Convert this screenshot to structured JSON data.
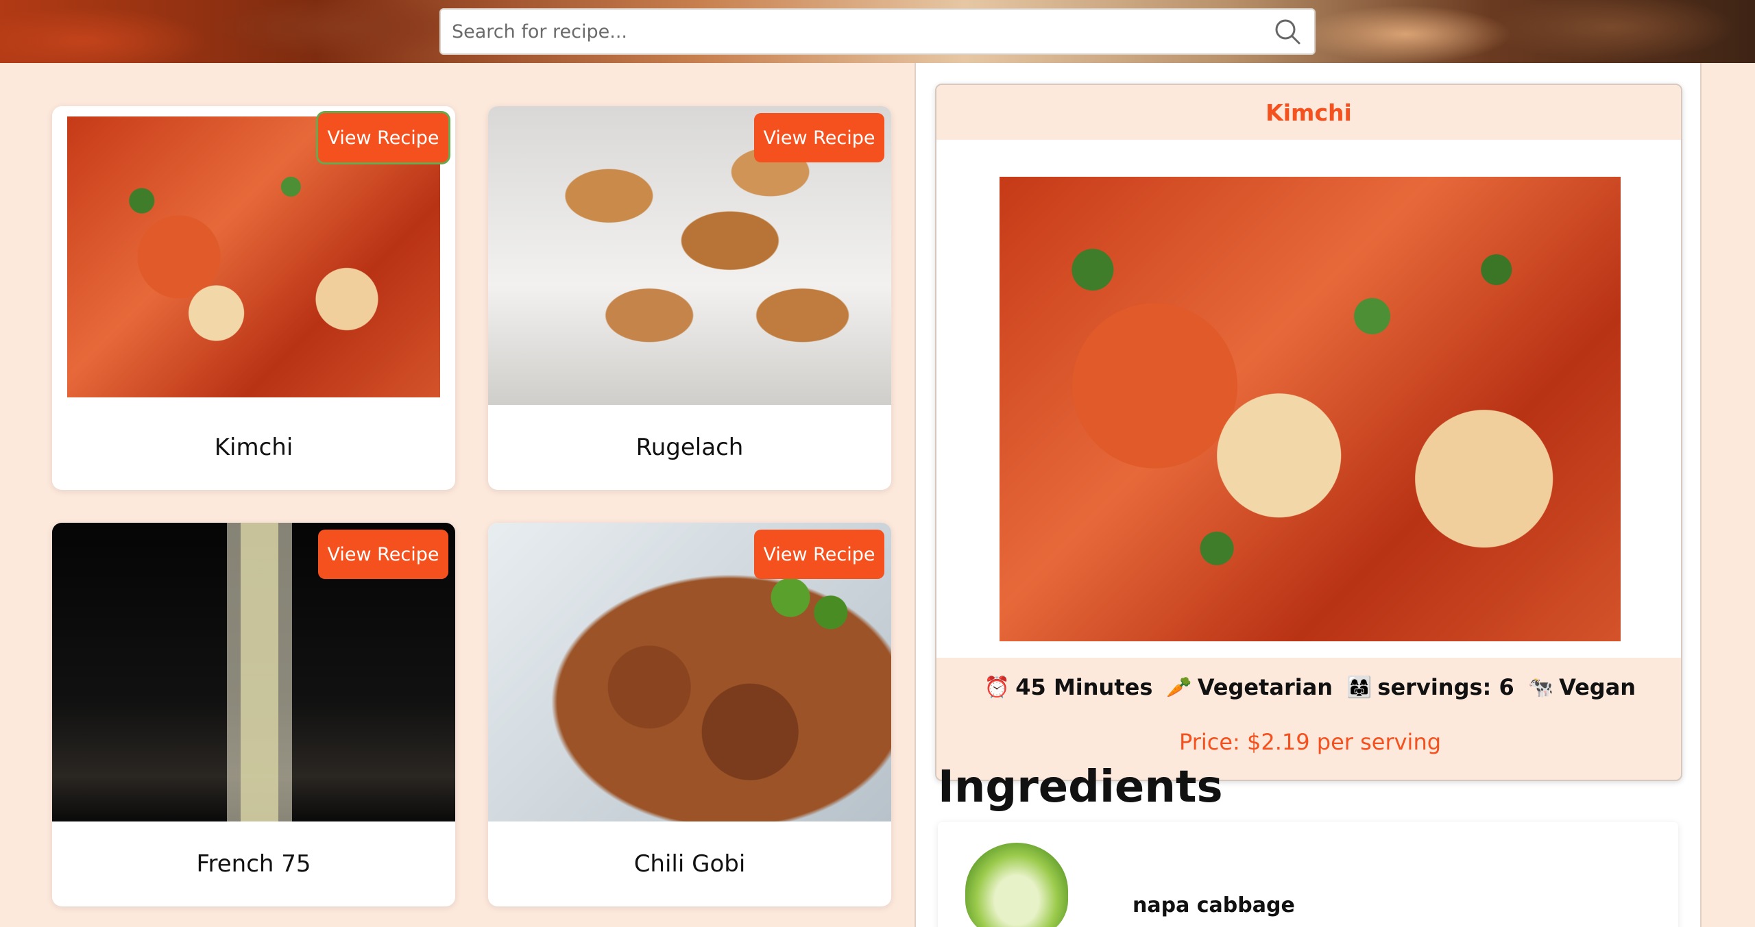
{
  "search": {
    "placeholder": "Search for recipe..."
  },
  "recipes": [
    {
      "name": "Kimchi",
      "button": "View Recipe"
    },
    {
      "name": "Rugelach",
      "button": "View Recipe"
    },
    {
      "name": "French 75",
      "button": "View Recipe"
    },
    {
      "name": "Chili Gobi",
      "button": "View Recipe"
    }
  ],
  "detail": {
    "title": "Kimchi",
    "time_icon": "⏰",
    "time": "45 Minutes",
    "vegetarian_icon": "🥕",
    "vegetarian": "Vegetarian",
    "servings_icon": "👩‍👩‍👧",
    "servings": "servings: 6",
    "vegan_icon": "🐄",
    "vegan": "Vegan",
    "price": "Price: $2.19 per serving"
  },
  "ingredients": {
    "heading": "Ingredients",
    "items": [
      {
        "name": "napa cabbage"
      }
    ]
  },
  "colors": {
    "accent": "#f4511e",
    "background": "#fde8dc"
  }
}
